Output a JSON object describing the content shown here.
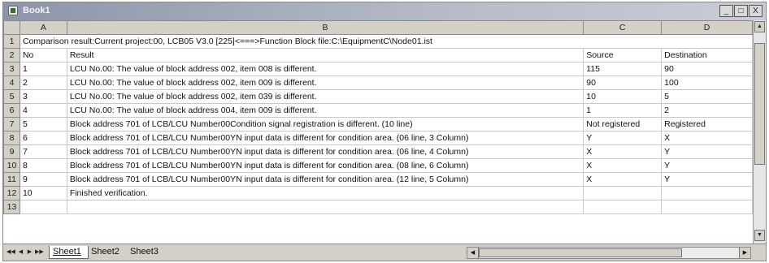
{
  "window": {
    "title": "Book1",
    "minimize_glyph": "_",
    "restore_glyph": "□",
    "close_glyph": "X"
  },
  "columns": [
    "A",
    "B",
    "C",
    "D"
  ],
  "rows": [
    {
      "num": "1",
      "a": "Comparison result:Current project:00,  LCB05 V3.0  [225]<===>Function Block file:C:\\EquipmentC\\Node01.ist",
      "b": "",
      "c": "",
      "d": "",
      "merged": true
    },
    {
      "num": "2",
      "a": "No",
      "b": "Result",
      "c": "Source",
      "d": "Destination"
    },
    {
      "num": "3",
      "a": "1",
      "b": "LCU No.00: The value of block address 002, item 008 is different.",
      "c": "115",
      "d": "90"
    },
    {
      "num": "4",
      "a": "2",
      "b": "LCU No.00: The value of block address 002, item 009 is different.",
      "c": "90",
      "d": "100"
    },
    {
      "num": "5",
      "a": "3",
      "b": "LCU No.00: The value of block address 002, item 039 is different.",
      "c": "10",
      "d": "5"
    },
    {
      "num": "6",
      "a": "4",
      "b": "LCU No.00: The value of block address 004, item 009 is different.",
      "c": "1",
      "d": "2"
    },
    {
      "num": "7",
      "a": "5",
      "b": "Block address 701 of LCB/LCU Number00Condition signal registration is different. (10 line)",
      "c": "Not registered",
      "d": "Registered"
    },
    {
      "num": "8",
      "a": "6",
      "b": "Block address 701 of LCB/LCU Number00YN input data is different for condition area. (06 line, 3 Column)",
      "c": "Y",
      "d": "X"
    },
    {
      "num": "9",
      "a": "7",
      "b": "Block address 701 of LCB/LCU Number00YN input data is different for condition area. (06 line, 4 Column)",
      "c": "X",
      "d": "Y"
    },
    {
      "num": "10",
      "a": "8",
      "b": "Block address 701 of LCB/LCU Number00YN input data is different for condition area. (08 line, 6 Column)",
      "c": "X",
      "d": "Y"
    },
    {
      "num": "11",
      "a": "9",
      "b": "Block address 701 of LCB/LCU Number00YN input data is different for condition area. (12 line, 5 Column)",
      "c": "X",
      "d": "Y"
    },
    {
      "num": "12",
      "a": "10",
      "b": "Finished verification.",
      "c": "",
      "d": ""
    },
    {
      "num": "13",
      "a": "",
      "b": "",
      "c": "",
      "d": ""
    }
  ],
  "sheet_tabs": [
    "Sheet1",
    "Sheet2",
    "Sheet3"
  ],
  "active_tab": "Sheet1",
  "nav_buttons": [
    "◀◀",
    "◀",
    "▶",
    "▶▶"
  ]
}
